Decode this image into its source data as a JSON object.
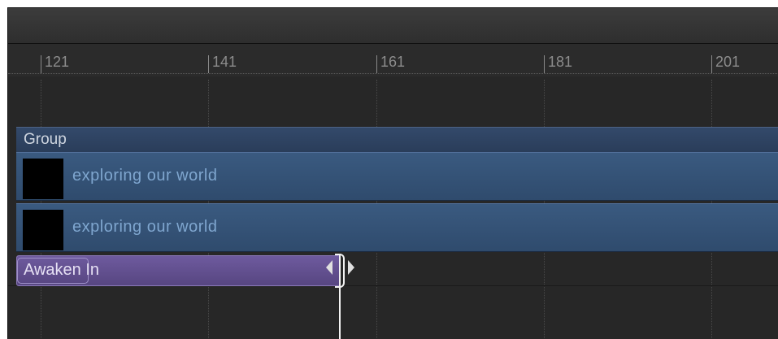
{
  "ruler": {
    "ticks": [
      {
        "label": "121"
      },
      {
        "label": "141"
      },
      {
        "label": "161"
      },
      {
        "label": "181"
      },
      {
        "label": "201"
      }
    ]
  },
  "timeline": {
    "group": {
      "label": "Group"
    },
    "layers": [
      {
        "label": "exploring our world"
      },
      {
        "label": "exploring our world"
      }
    ],
    "behavior": {
      "label": "Awaken In"
    }
  },
  "colors": {
    "group": "#2a3d5a",
    "layer": "#2f4b6d",
    "layer_text": "#7fa6cf",
    "behavior": "#574681",
    "playhead": "#f2f2f2"
  }
}
